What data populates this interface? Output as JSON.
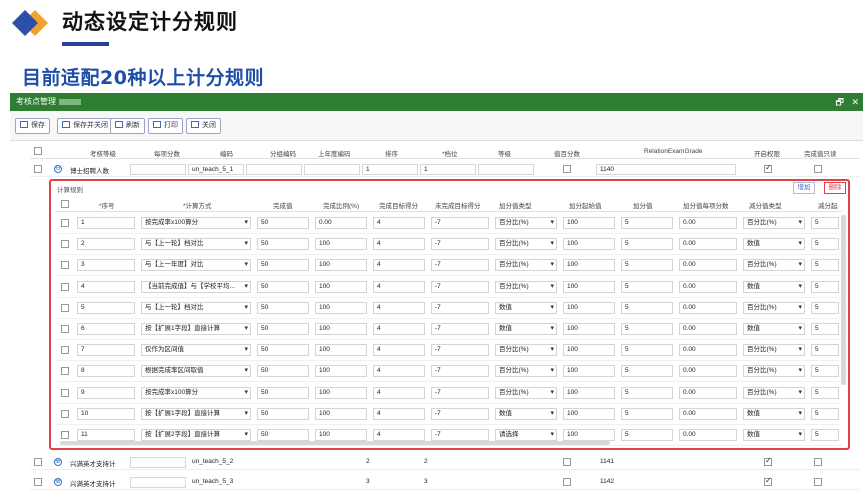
{
  "slide": {
    "title": "动态设定计分规则",
    "subtitle": "目前适配20种以上计分规则"
  },
  "window": {
    "title": "考核点管理",
    "ctrl_restore": "🗗",
    "ctrl_close": "✕"
  },
  "toolbar": {
    "save": "保存",
    "save_close": "保存并关闭",
    "refresh": "刷新",
    "print": "打印",
    "close": "关闭"
  },
  "outer_table": {
    "headers": [
      "考核等级",
      "每项分数",
      "编码",
      "分组编码",
      "上年度编码",
      "排序",
      "*档位",
      "等级",
      "值百分数",
      "RelationExamGrade",
      "开启权限",
      "完成值只读"
    ],
    "rows": [
      {
        "name": "博士招聘人数",
        "code": "un_teach_5_1",
        "sort": "1",
        "level": "1",
        "grade": "1140",
        "toggle": "⊖"
      },
      {
        "name": "兴满英才支持计",
        "code": "un_teach_5_2",
        "sort": "2",
        "level": "2",
        "grade": "1141",
        "toggle": "⊕"
      },
      {
        "name": "兴满英才支持计",
        "code": "un_teach_5_3",
        "sort": "3",
        "level": "3",
        "grade": "1142",
        "toggle": "⊕"
      }
    ]
  },
  "rules": {
    "label": "计算规则",
    "add": "增加",
    "delete": "删除",
    "headers": [
      "*序号",
      "*计算方式",
      "完成值",
      "完成比例(%)",
      "完成目标得分",
      "未完成目标得分",
      "加分值类型",
      "加分起始值",
      "加分值",
      "加分值每项分数",
      "减分值类型",
      "减分起"
    ],
    "rows": [
      {
        "no": "1",
        "method": "按完成率x100算分",
        "done": "50",
        "ratio": "0.00",
        "target": "4",
        "miss": "-7",
        "addType": "百分比(%)",
        "addStart": "100",
        "addVal": "5",
        "addEach": "0.00",
        "subType": "百分比(%)",
        "subStart": "5"
      },
      {
        "no": "2",
        "method": "与【上一轮】档对比",
        "done": "50",
        "ratio": "100",
        "target": "4",
        "miss": "-7",
        "addType": "百分比(%)",
        "addStart": "100",
        "addVal": "5",
        "addEach": "0.00",
        "subType": "数值",
        "subStart": "5"
      },
      {
        "no": "3",
        "method": "与【上一年度】对比",
        "done": "50",
        "ratio": "100",
        "target": "4",
        "miss": "-7",
        "addType": "百分比(%)",
        "addStart": "100",
        "addVal": "5",
        "addEach": "0.00",
        "subType": "百分比(%)",
        "subStart": "5"
      },
      {
        "no": "4",
        "method": "【当前完成值】与【学校平均...",
        "done": "50",
        "ratio": "100",
        "target": "4",
        "miss": "-7",
        "addType": "百分比(%)",
        "addStart": "100",
        "addVal": "5",
        "addEach": "0.00",
        "subType": "数值",
        "subStart": "5"
      },
      {
        "no": "5",
        "method": "与【上一轮】档对比",
        "done": "50",
        "ratio": "100",
        "target": "4",
        "miss": "-7",
        "addType": "数值",
        "addStart": "100",
        "addVal": "5",
        "addEach": "0.00",
        "subType": "百分比(%)",
        "subStart": "5"
      },
      {
        "no": "6",
        "method": "按【扩展1字段】直接计算",
        "done": "50",
        "ratio": "100",
        "target": "4",
        "miss": "-7",
        "addType": "数值",
        "addStart": "100",
        "addVal": "5",
        "addEach": "0.00",
        "subType": "数值",
        "subStart": "5"
      },
      {
        "no": "7",
        "method": "仅作为区间值",
        "done": "50",
        "ratio": "100",
        "target": "4",
        "miss": "-7",
        "addType": "百分比(%)",
        "addStart": "100",
        "addVal": "5",
        "addEach": "0.00",
        "subType": "百分比(%)",
        "subStart": "5"
      },
      {
        "no": "8",
        "method": "根据完成率区间取值",
        "done": "50",
        "ratio": "100",
        "target": "4",
        "miss": "-7",
        "addType": "百分比(%)",
        "addStart": "100",
        "addVal": "5",
        "addEach": "0.00",
        "subType": "百分比(%)",
        "subStart": "5"
      },
      {
        "no": "9",
        "method": "按完成率x100算分",
        "done": "50",
        "ratio": "100",
        "target": "4",
        "miss": "-7",
        "addType": "百分比(%)",
        "addStart": "100",
        "addVal": "5",
        "addEach": "0.00",
        "subType": "百分比(%)",
        "subStart": "5"
      },
      {
        "no": "10",
        "method": "按【扩展1字段】直接计算",
        "done": "50",
        "ratio": "100",
        "target": "4",
        "miss": "-7",
        "addType": "数值",
        "addStart": "100",
        "addVal": "5",
        "addEach": "0.00",
        "subType": "数值",
        "subStart": "5"
      },
      {
        "no": "11",
        "method": "按【扩展2字段】直接计算",
        "done": "50",
        "ratio": "100",
        "target": "4",
        "miss": "-7",
        "addType": "请选择",
        "addStart": "100",
        "addVal": "5",
        "addEach": "0.00",
        "subType": "数值",
        "subStart": "5"
      }
    ]
  },
  "colors": {
    "accent_blue": "#1f4ea8",
    "window_green": "#2e7d32",
    "highlight_red": "#e0424a"
  }
}
